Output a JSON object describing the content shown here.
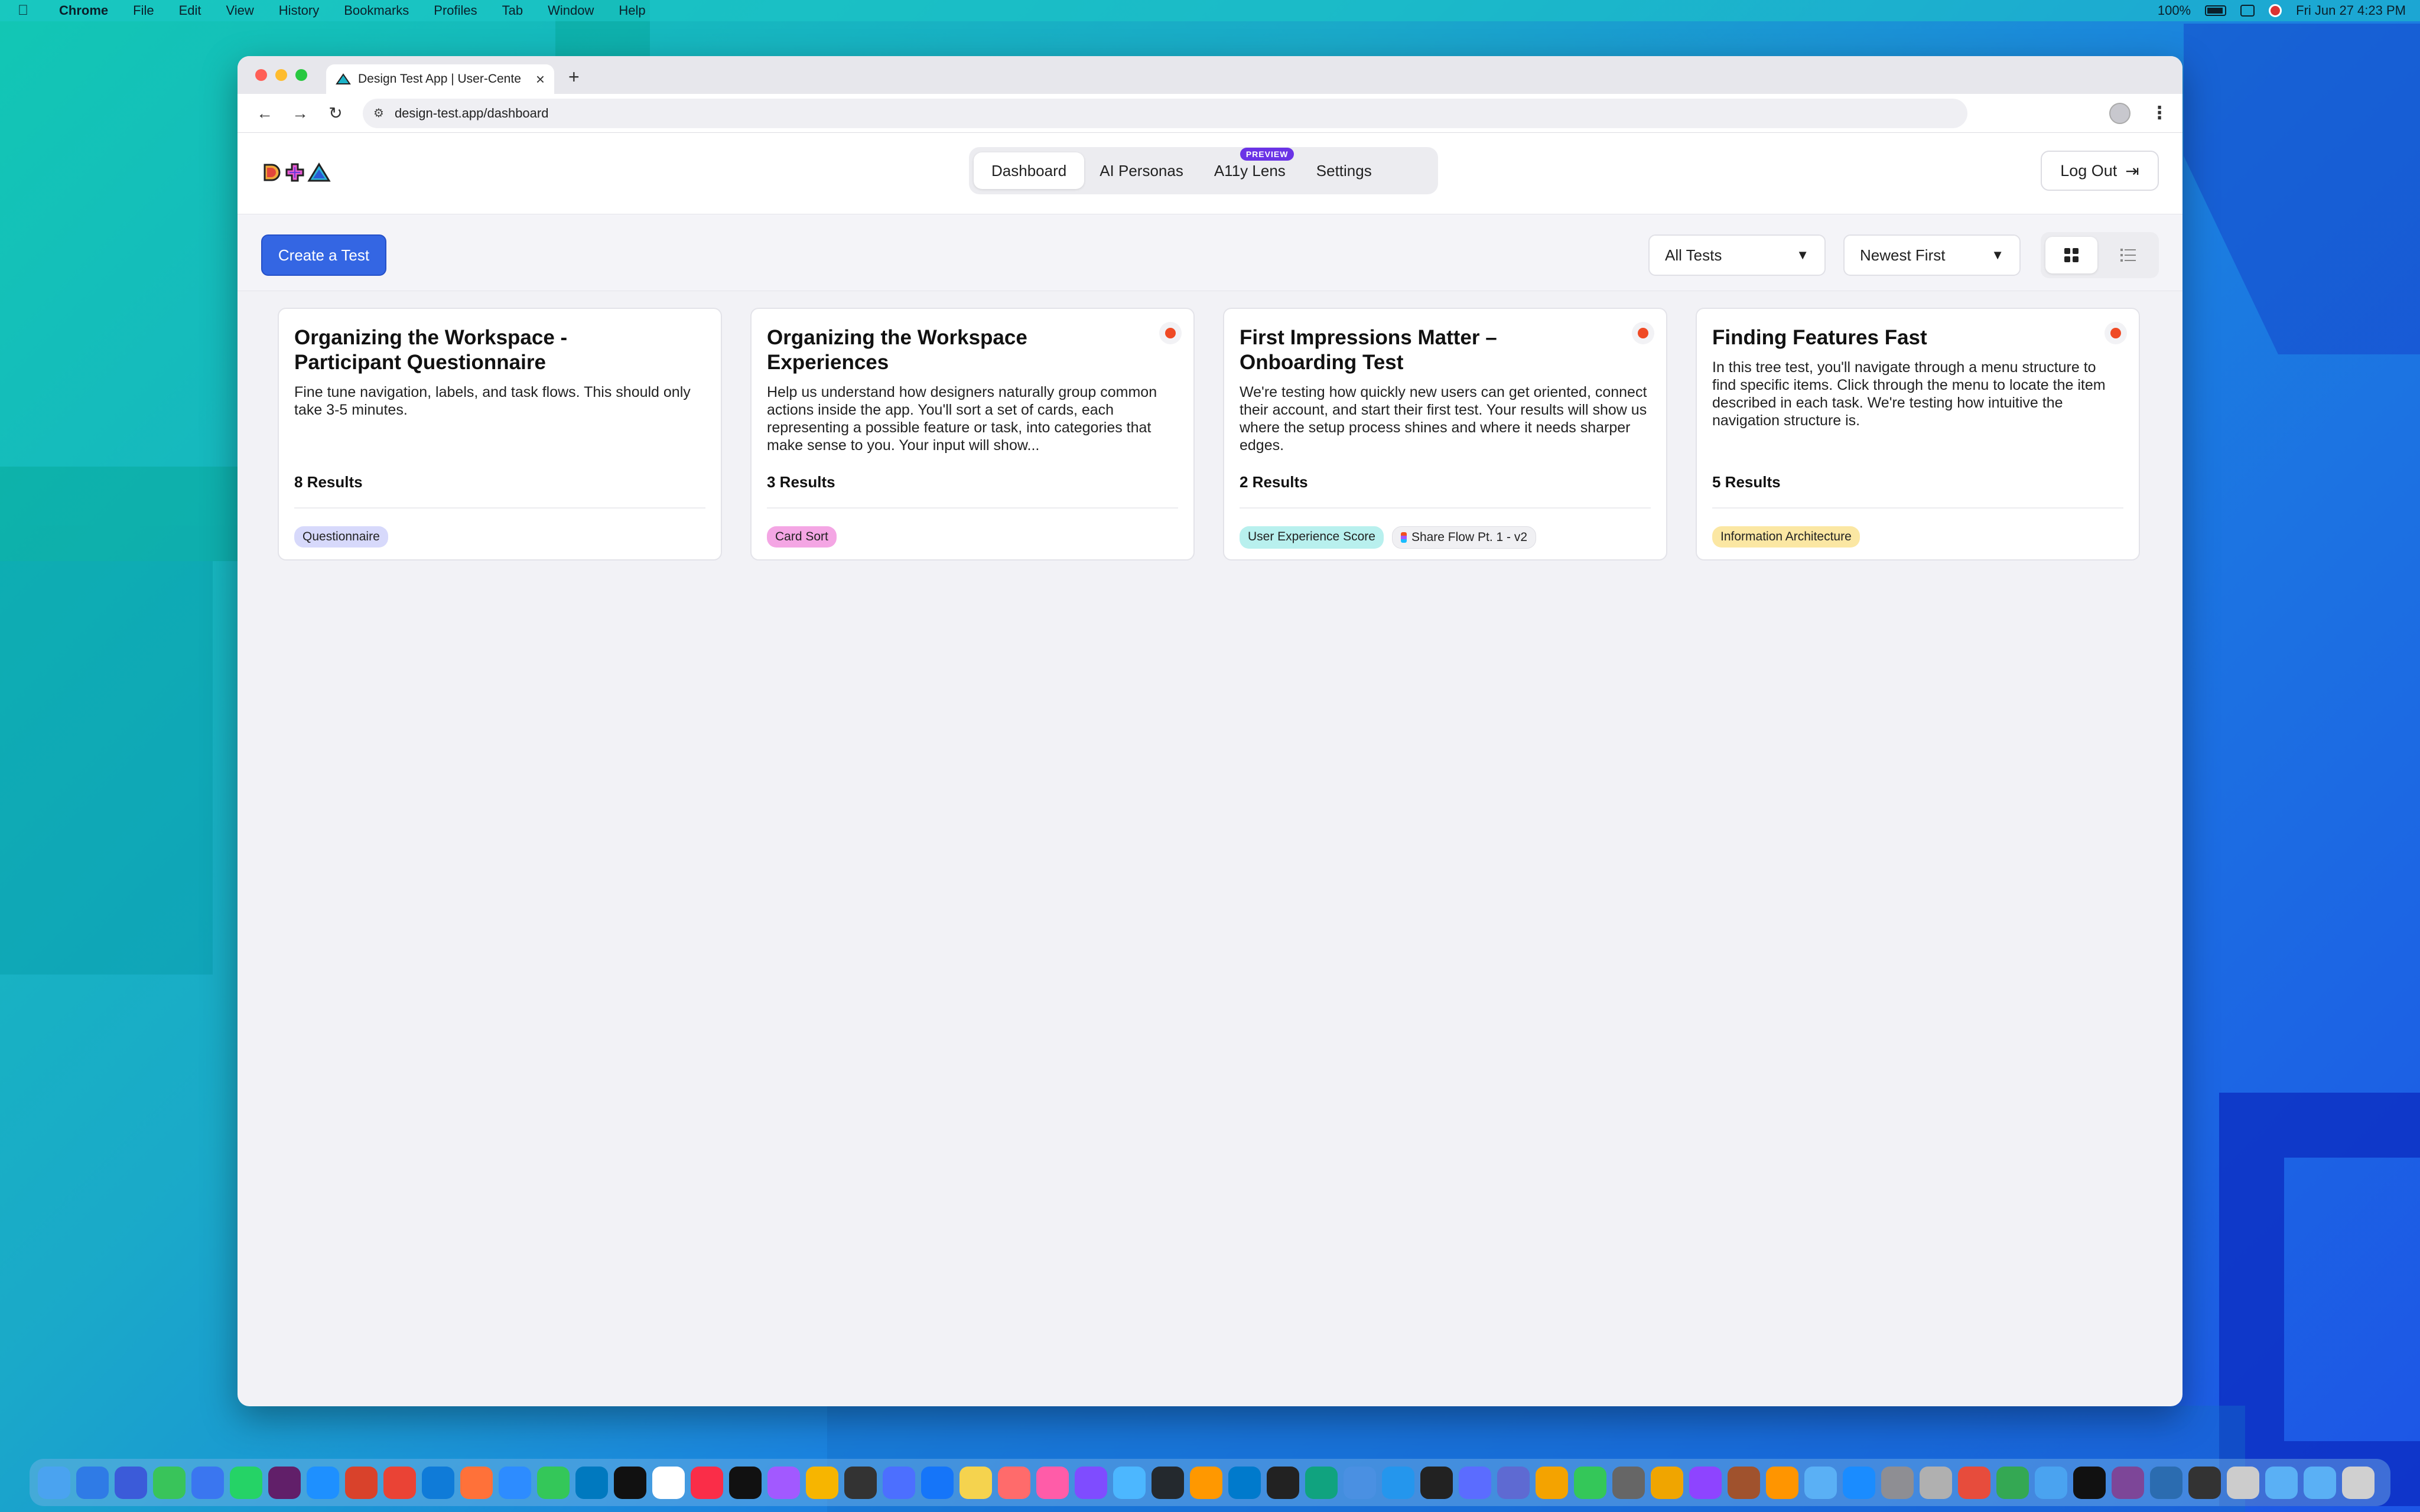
{
  "menubar": {
    "apple": "",
    "app": "Chrome",
    "items": [
      "File",
      "Edit",
      "View",
      "History",
      "Bookmarks",
      "Profiles",
      "Tab",
      "Window",
      "Help"
    ],
    "battery": "100%",
    "datetime": "Fri Jun 27  4:23 PM"
  },
  "browser": {
    "tab_title": "Design Test App | User-Cente",
    "url": "design-test.app/dashboard"
  },
  "app": {
    "nav": {
      "dashboard": "Dashboard",
      "personas": "AI Personas",
      "a11y": "A11y Lens",
      "preview": "PREVIEW",
      "settings": "Settings"
    },
    "logout": "Log Out",
    "create": "Create a Test",
    "filter": "All Tests",
    "sort": "Newest First"
  },
  "cards": [
    {
      "title": "Organizing the Workspace - Participant Questionnaire",
      "desc": "Fine tune navigation, labels, and task flows. This should only take 3-5 minutes.",
      "results": "8 Results",
      "tags": [
        "Questionnaire"
      ]
    },
    {
      "title": "Organizing the Workspace Experiences",
      "desc": "Help us understand how designers naturally group common actions inside the app. You'll sort a set of cards, each representing a possible feature or task, into categories that make sense to you. Your input will show...",
      "results": "3 Results",
      "tags": [
        "Card Sort"
      ]
    },
    {
      "title": "First Impressions Matter – Onboarding Test",
      "desc": "We're testing how quickly new users can get oriented, connect their account, and start their first test. Your results will show us where the setup process shines and where it needs sharper edges.",
      "results": "2 Results",
      "tags": [
        "User Experience Score",
        "Share Flow Pt. 1 - v2"
      ]
    },
    {
      "title": "Finding Features Fast",
      "desc": "In this tree test, you'll navigate through a menu structure to find specific items. Click through the menu to locate the item described in each task. We're testing how intuitive the navigation structure is.",
      "results": "5 Results",
      "tags": [
        "Information Architecture"
      ]
    }
  ],
  "colors": {
    "primary": "#3466e3",
    "record": "#ef4a25",
    "preview": "#6a33e6"
  },
  "dock": [
    "finder",
    "mail",
    "mail-blue",
    "messages",
    "signal",
    "whatsapp",
    "slack",
    "safari",
    "affinity",
    "chrome",
    "edge",
    "firefox",
    "zoom",
    "facetime",
    "trello",
    "notion",
    "calendar",
    "music",
    "tv",
    "figma",
    "sketch",
    "fontforge",
    "pixelmator",
    "xcode",
    "notes",
    "clips",
    "shapes",
    "affinity-designer",
    "affinity-photo",
    "github",
    "sublime",
    "vscode",
    "terminal-app",
    "chatgpt",
    "screenshot",
    "docker",
    "terminal",
    "layers",
    "linear",
    "pages",
    "numbers",
    "calculator",
    "photos",
    "podcasts",
    "archive",
    "home",
    "preview",
    "appstore",
    "settings",
    "keychain",
    "pdf",
    "drive",
    "finder2",
    "notion2",
    "tor",
    "library",
    "screen",
    "window",
    "folder",
    "downloads",
    "trash"
  ]
}
